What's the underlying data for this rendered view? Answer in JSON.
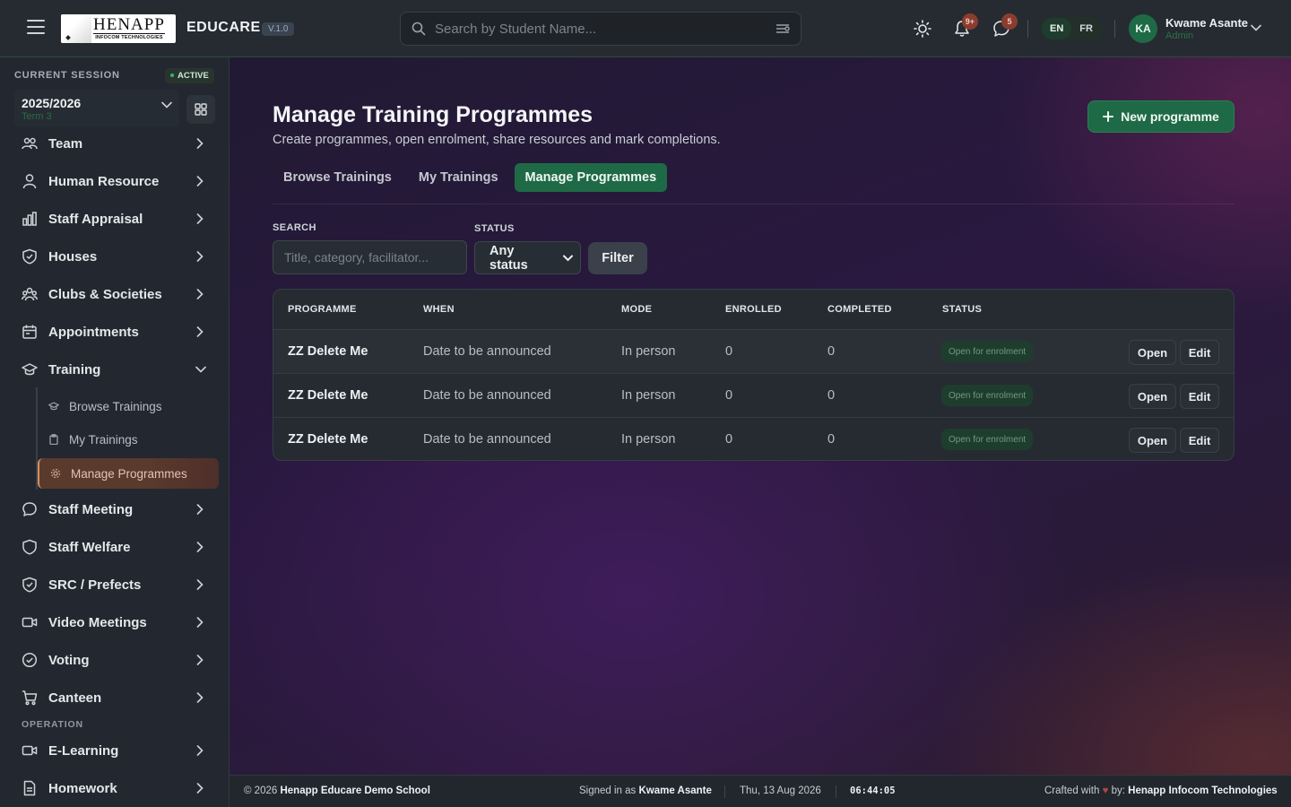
{
  "header": {
    "logo_big": "HENAPP",
    "logo_small": "INFOCOM TECHNOLOGIES",
    "brand": "EDUCARE",
    "version": "V.1.0",
    "search_placeholder": "Search by Student Name...",
    "notifications_badge": "9+",
    "messages_badge": "5",
    "lang_en": "EN",
    "lang_fr": "FR",
    "user_initials": "KA",
    "user_name": "Kwame Asante",
    "user_role": "Admin",
    "accent_color": "#1f6a46"
  },
  "sidebar": {
    "session_label": "CURRENT SESSION",
    "active_label": "ACTIVE",
    "session_year": "2025/2026",
    "session_term": "Term 3",
    "items": [
      {
        "label": "Team",
        "icon": "team-icon"
      },
      {
        "label": "Human Resource",
        "icon": "user-icon"
      },
      {
        "label": "Staff Appraisal",
        "icon": "bar-chart-icon"
      },
      {
        "label": "Houses",
        "icon": "shield-icon"
      },
      {
        "label": "Clubs & Societies",
        "icon": "users-icon"
      },
      {
        "label": "Appointments",
        "icon": "calendar-icon"
      },
      {
        "label": "Training",
        "icon": "graduation-cap-icon"
      },
      {
        "label": "Staff Meeting",
        "icon": "chat-icon"
      },
      {
        "label": "Staff Welfare",
        "icon": "shield-icon"
      },
      {
        "label": "SRC / Prefects",
        "icon": "shield-check-icon"
      },
      {
        "label": "Video Meetings",
        "icon": "video-icon"
      },
      {
        "label": "Voting",
        "icon": "check-circle-icon"
      },
      {
        "label": "Canteen",
        "icon": "cart-icon"
      }
    ],
    "training_sub": [
      {
        "label": "Browse Trainings",
        "icon": "graduation-cap-icon"
      },
      {
        "label": "My Trainings",
        "icon": "clipboard-icon"
      },
      {
        "label": "Manage Programmes",
        "icon": "gear-icon"
      }
    ],
    "operation_label": "OPERATION",
    "operation_items": [
      {
        "label": "E-Learning",
        "icon": "video-icon"
      },
      {
        "label": "Homework",
        "icon": "document-icon"
      }
    ]
  },
  "main": {
    "title": "Manage Training Programmes",
    "subtitle": "Create programmes, open enrolment, share resources and mark completions.",
    "new_button": "New programme",
    "tabs": [
      "Browse Trainings",
      "My Trainings",
      "Manage Programmes"
    ],
    "active_tab": "Manage Programmes",
    "filters": {
      "search_label": "SEARCH",
      "search_placeholder": "Title, category, facilitator...",
      "status_label": "STATUS",
      "status_value": "Any status",
      "filter_button": "Filter"
    },
    "table": {
      "columns": [
        "PROGRAMME",
        "WHEN",
        "MODE",
        "ENROLLED",
        "COMPLETED",
        "STATUS"
      ],
      "rows": [
        {
          "programme": "ZZ Delete Me",
          "when": "Date to be announced",
          "mode": "In person",
          "enrolled": "0",
          "completed": "0",
          "status": "Open for enrolment",
          "open": "Open",
          "edit": "Edit"
        },
        {
          "programme": "ZZ Delete Me",
          "when": "Date to be announced",
          "mode": "In person",
          "enrolled": "0",
          "completed": "0",
          "status": "Open for enrolment",
          "open": "Open",
          "edit": "Edit"
        },
        {
          "programme": "ZZ Delete Me",
          "when": "Date to be announced",
          "mode": "In person",
          "enrolled": "0",
          "completed": "0",
          "status": "Open for enrolment",
          "open": "Open",
          "edit": "Edit"
        }
      ]
    }
  },
  "footer": {
    "copyright_prefix": "© 2026",
    "school": "Henapp Educare Demo School",
    "signed_prefix": "Signed in as",
    "signed_user": "Kwame Asante",
    "date": "Thu, 13 Aug 2026",
    "time": "06:44:05",
    "crafted_prefix": "Crafted with",
    "crafted_by": "by:",
    "company": "Henapp Infocom Technologies"
  }
}
